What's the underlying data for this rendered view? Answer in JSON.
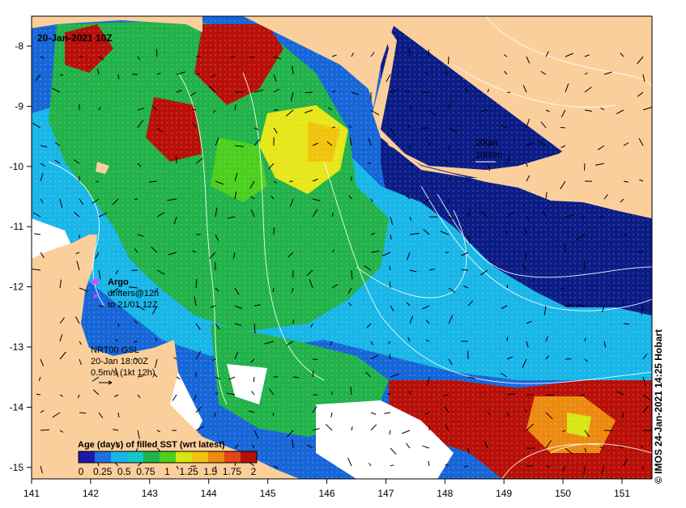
{
  "map": {
    "date_label": "20-Jan-2021 10Z",
    "lon_ticks": [
      "141",
      "142",
      "143",
      "144",
      "145",
      "146",
      "147",
      "148",
      "149",
      "150",
      "151"
    ],
    "lat_ticks": [
      "-8",
      "-9",
      "-10",
      "-11",
      "-12",
      "-13",
      "-14",
      "-15"
    ],
    "contour_labels": [
      "200m",
      "1000m"
    ],
    "argo": {
      "title": "Argo",
      "line1": "drifters@12h",
      "line2": "to 21/01 12Z"
    },
    "current": {
      "line1": "NRT00 GSL",
      "line2": "20-Jan 18:00Z",
      "line3": "0.5m/s (1kt 12h)"
    },
    "colorbar": {
      "title": "Age (days) of filled SST (wrt latest)",
      "ticks": [
        "0",
        "0.25",
        "0.5",
        "0.75",
        "1",
        "1.25",
        "1.5",
        "1.75",
        "2"
      ],
      "colors": [
        "#1a1aa8",
        "#1f6fe0",
        "#19b4e6",
        "#17c7c7",
        "#22b24a",
        "#4ccf1e",
        "#d6e615",
        "#f0c40c",
        "#ec8a10",
        "#e2451a",
        "#b81008"
      ]
    },
    "credit": "© IMOS 24-Jan-2021 14:25 Hobart",
    "colors": {
      "land": "#fbcf9b",
      "deep": "#0a1a80",
      "green": "#22b24a",
      "cyan": "#18b4e8",
      "red": "#b81008"
    }
  }
}
